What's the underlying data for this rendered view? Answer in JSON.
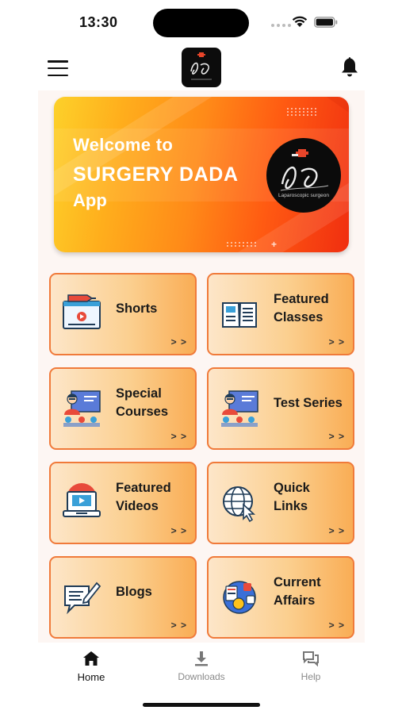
{
  "status_bar": {
    "time": "13:30"
  },
  "header": {
    "logo_name": "surgery-dada-logo"
  },
  "banner": {
    "line1": "Welcome to",
    "line2": "SURGERY DADA",
    "line3": "App",
    "emblem_caption": "Laparoscopic surgeon"
  },
  "tiles": [
    {
      "label": "Shorts",
      "arrow": "> >",
      "icon": "video-player-icon"
    },
    {
      "label": "Featured Classes",
      "line1": "Featured",
      "line2": "Classes",
      "arrow": "> >",
      "icon": "open-book-icon"
    },
    {
      "label": "Special Courses",
      "line1": "Special",
      "line2": "Courses",
      "arrow": "> >",
      "icon": "teacher-board-icon"
    },
    {
      "label": "Test Series",
      "arrow": "> >",
      "icon": "teacher-board-icon"
    },
    {
      "label": "Featured Videos",
      "line1": "Featured",
      "line2": "Videos",
      "arrow": "> >",
      "icon": "video-laptop-icon"
    },
    {
      "label": "Quick Links",
      "line1": "Quick",
      "line2": "Links",
      "arrow": "> >",
      "icon": "globe-cursor-icon"
    },
    {
      "label": "Blogs",
      "arrow": "> >",
      "icon": "blog-pen-icon"
    },
    {
      "label": "Current Affairs",
      "line1": "Current",
      "line2": "Affairs",
      "arrow": "> >",
      "icon": "news-globe-icon"
    }
  ],
  "bottom_nav": {
    "home": "Home",
    "downloads": "Downloads",
    "help": "Help"
  },
  "colors": {
    "tile_border": "#f07a3a",
    "banner_start": "#fdd12a",
    "banner_end": "#f02e10",
    "accent_text": "#1a1a1a"
  }
}
